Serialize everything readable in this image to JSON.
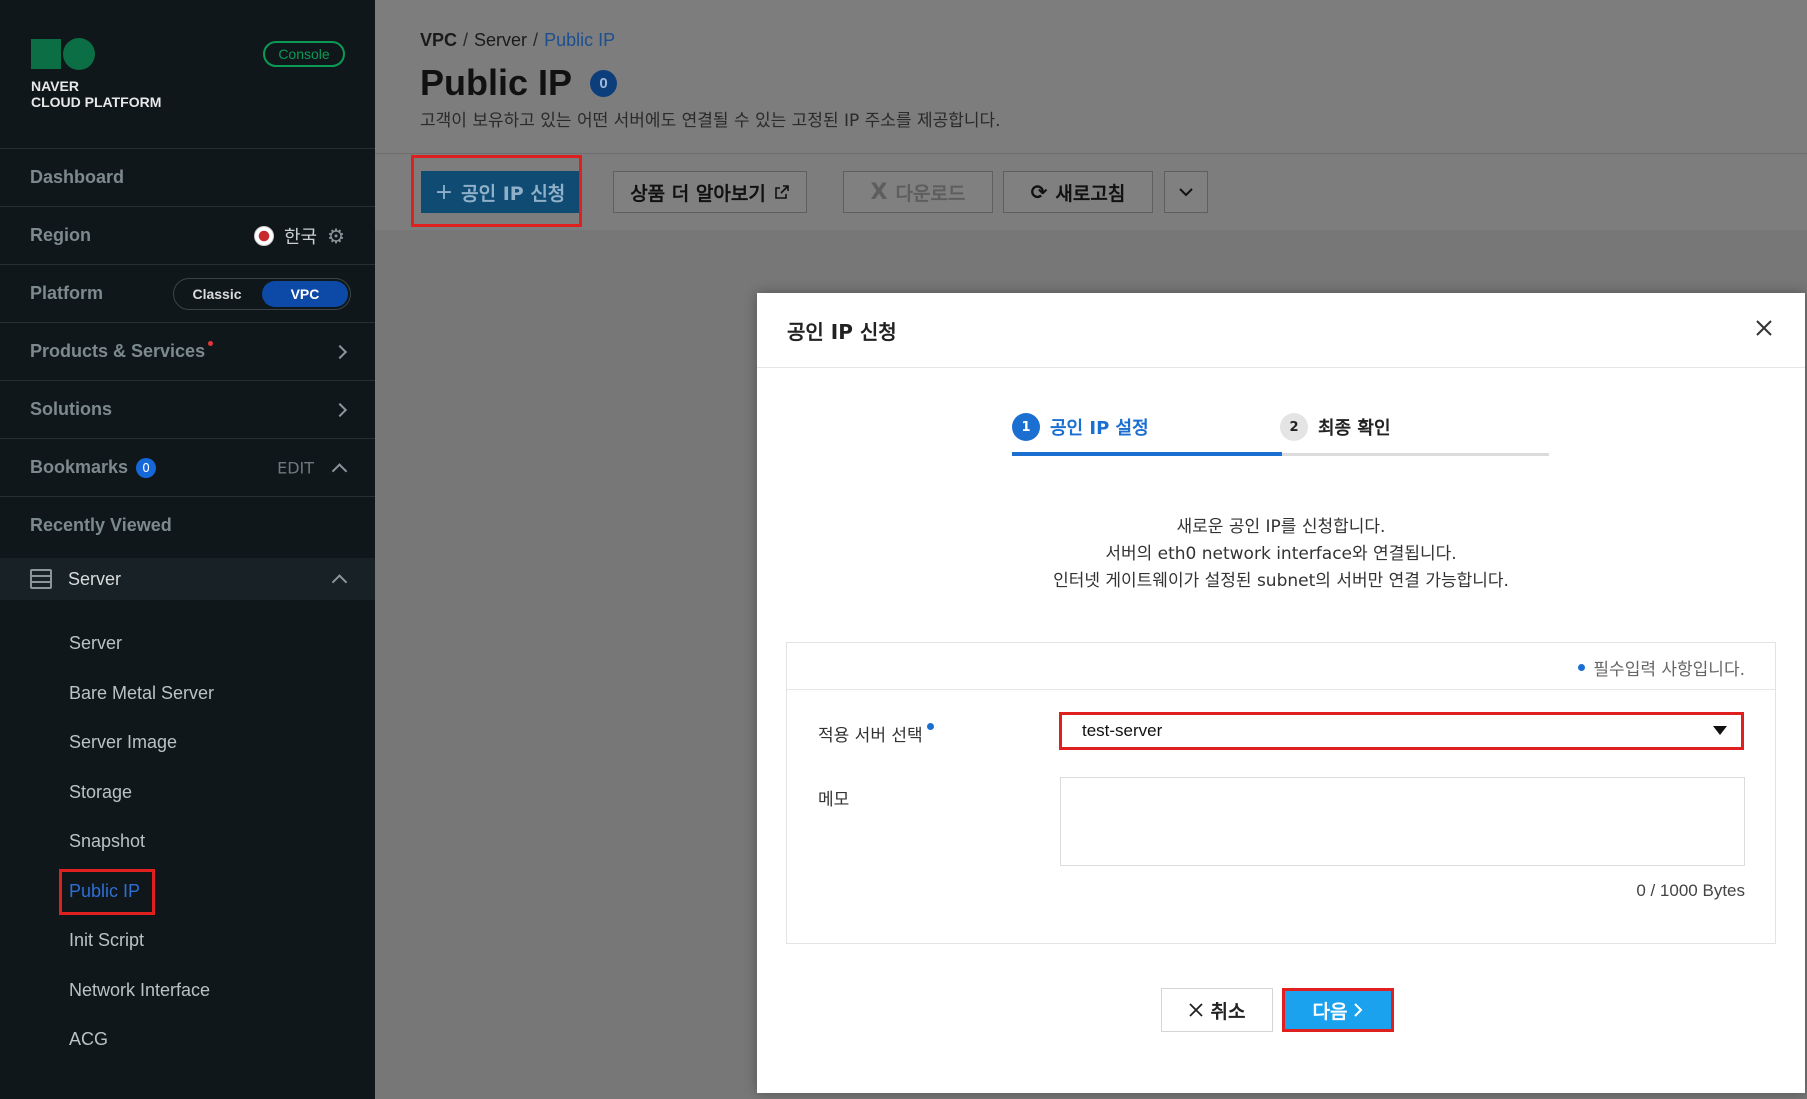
{
  "brand": {
    "logo_line1": "NAVER",
    "logo_line2": "CLOUD PLATFORM",
    "console_badge": "Console",
    "accent_color": "#0b6e44"
  },
  "sidebar": {
    "dashboard": "Dashboard",
    "region_label": "Region",
    "region_value": "한국",
    "platform_label": "Platform",
    "platform_options": [
      "Classic",
      "VPC"
    ],
    "platform_selected": "VPC",
    "products": "Products & Services",
    "solutions": "Solutions",
    "bookmarks": "Bookmarks",
    "bookmarks_count": "0",
    "bookmarks_edit": "EDIT",
    "recently_viewed": "Recently Viewed",
    "server_group": "Server",
    "server_items": [
      "Server",
      "Bare Metal Server",
      "Server Image",
      "Storage",
      "Snapshot",
      "Public IP",
      "Init Script",
      "Network Interface",
      "ACG"
    ],
    "active_item": "Public IP"
  },
  "header": {
    "breadcrumb": [
      "VPC",
      "Server",
      "Public IP"
    ],
    "breadcrumb_sep": "/",
    "title": "Public IP",
    "count": "0",
    "description": "고객이 보유하고 있는 어떤 서버에도 연결될 수 있는 고정된 IP 주소를 제공합니다."
  },
  "toolbar": {
    "apply_label": "공인 IP 신청",
    "learn_more_label": "상품 더 알아보기",
    "download_label": "다운로드",
    "refresh_label": "새로고침"
  },
  "modal": {
    "title": "공인 IP 신청",
    "steps": [
      {
        "num": "1",
        "label": "공인 IP 설정"
      },
      {
        "num": "2",
        "label": "최종 확인"
      }
    ],
    "current_step": 1,
    "intro_lines": [
      "새로운 공인 IP를 신청합니다.",
      "서버의 eth0 network interface와 연결됩니다.",
      "인터넷 게이트웨이가 설정된 subnet의 서버만 연결 가능합니다."
    ],
    "required_note": "필수입력 사항입니다.",
    "server_label": "적용 서버 선택",
    "server_value": "test-server",
    "memo_label": "메모",
    "memo_value": "",
    "byte_count": "0 / 1000 Bytes",
    "cancel_label": "취소",
    "next_label": "다음"
  },
  "icons": [
    "gear-icon",
    "chevron-right-icon",
    "chevron-up-icon",
    "server-icon",
    "plus-icon",
    "external-link-icon",
    "excel-icon",
    "refresh-icon",
    "chevron-down-icon",
    "close-icon",
    "caret-down-icon"
  ]
}
